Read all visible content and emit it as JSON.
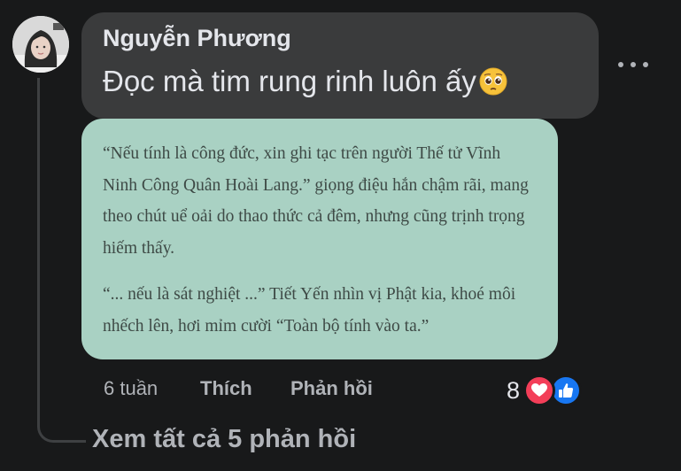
{
  "comment": {
    "author": "Nguyễn Phương",
    "text": "Đọc mà tim rung rinh luôn ấy",
    "emoji": "pleading-face-emoji"
  },
  "card": {
    "paragraphs": [
      "“Nếu tính là công đức, xin ghi tạc trên người Thế tử Vĩnh Ninh Công Quân Hoài Lang.” giọng điệu hắn chậm rãi, mang theo chút uể oải do thao thức cả đêm, nhưng cũng trịnh trọng hiếm thấy.",
      "“... nếu là sát nghiệt ...” Tiết Yến nhìn vị Phật kia, khoé môi nhếch lên, hơi mỉm cười “Toàn bộ tính vào ta.”"
    ],
    "background": "#a9d1c3"
  },
  "meta": {
    "time": "6 tuần",
    "like_label": "Thích",
    "reply_label": "Phản hồi"
  },
  "reactions": {
    "count": "8",
    "icons": [
      "heart-reaction-icon",
      "like-reaction-icon"
    ]
  },
  "view_replies": "Xem tất cả 5 phản hồi",
  "colors": {
    "background": "#18191a",
    "bubble": "#3a3b3c",
    "text": "#e4e6eb",
    "secondary": "#b0b3b8",
    "heart": "#f33e58",
    "like": "#1877f2"
  }
}
